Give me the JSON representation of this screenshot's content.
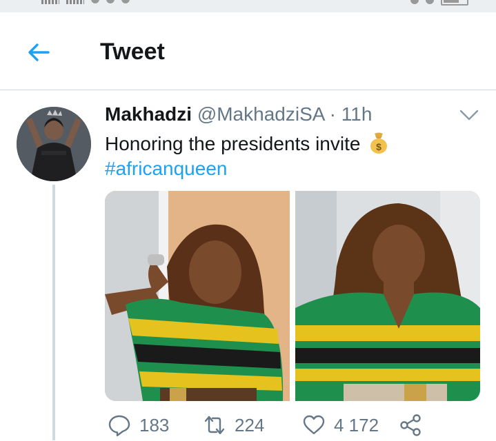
{
  "header": {
    "title": "Tweet"
  },
  "tweet": {
    "display_name": "Makhadzi",
    "handle": "@MakhadziSA",
    "separator": "·",
    "time": "11h",
    "text": "Honoring the presidents invite",
    "hashtag": "#africanqueen"
  },
  "actions": {
    "replies": "183",
    "retweets": "224",
    "likes": "4 172"
  },
  "colors": {
    "accent": "#1da1f2",
    "secondary_text": "#657786",
    "divider": "#cfd9de"
  },
  "icons": [
    "back-arrow-icon",
    "chevron-down-icon",
    "money-bag-icon",
    "reply-icon",
    "retweet-icon",
    "like-icon",
    "share-icon"
  ]
}
